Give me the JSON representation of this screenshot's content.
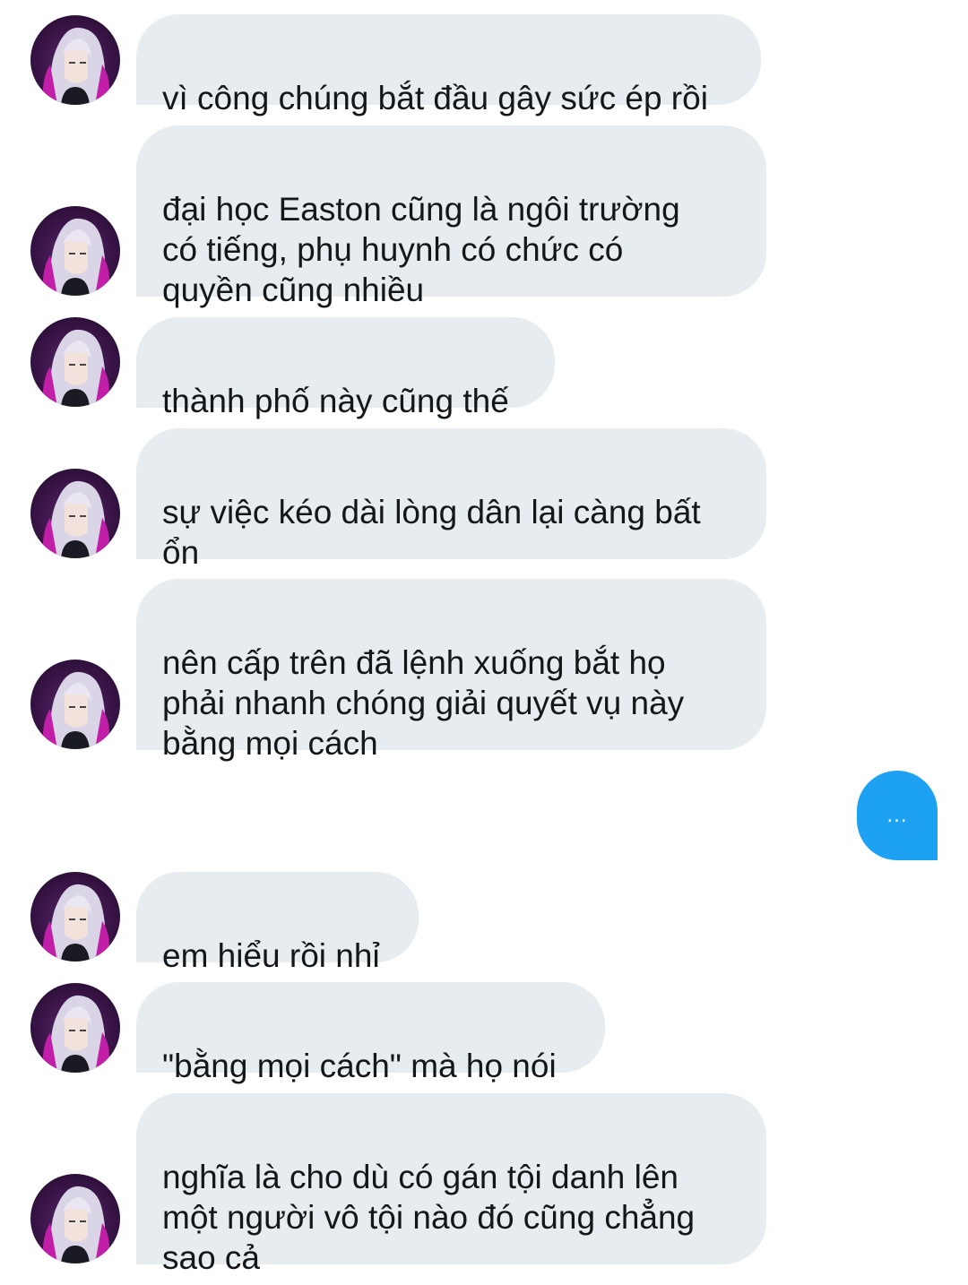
{
  "conversation": {
    "messages": [
      {
        "text": "vì công chúng bắt đầu gây sức ép rồi"
      },
      {
        "text": "đại học Easton cũng là ngôi trường\ncó tiếng, phụ huynh có chức có\nquyền cũng nhiều"
      },
      {
        "text": "thành phố này cũng thế"
      },
      {
        "text": "sự việc kéo dài lòng dân lại càng bất\nổn"
      },
      {
        "text": "nên cấp trên đã lệnh xuống bắt họ\nphải nhanh chóng giải quyết vụ này\nbằng mọi cách"
      },
      {
        "text": "em hiểu rồi nhỉ"
      },
      {
        "text": "\"bằng mọi cách\" mà họ nói"
      },
      {
        "text": "nghĩa là cho dù có gán tội danh lên\nmột người vô tội nào đó cũng chẳng\nsao cả"
      }
    ],
    "sent": {
      "text": "..."
    }
  },
  "colors": {
    "received_bubble": "#e6ecf0",
    "sent_bubble": "#1da1f2",
    "text": "#14171a"
  },
  "icons": {
    "avatar": "anime-character-avatar"
  }
}
